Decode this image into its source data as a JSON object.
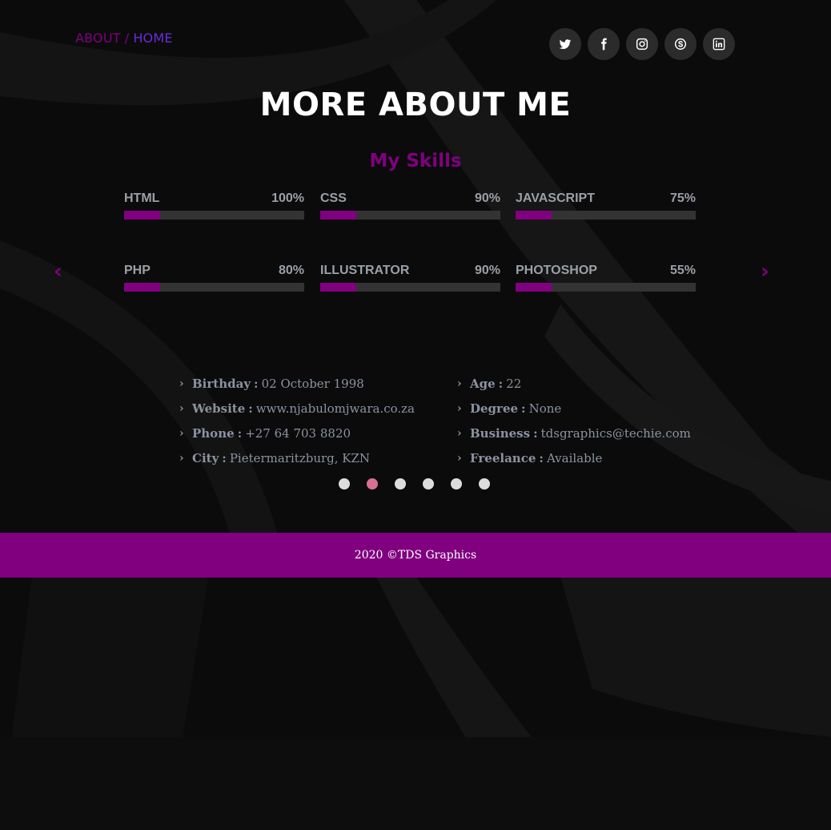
{
  "breadcrumb": {
    "about": "ABOUT",
    "separator": "/",
    "home": "HOME"
  },
  "socials": [
    {
      "icon": "twitter-icon"
    },
    {
      "icon": "facebook-icon"
    },
    {
      "icon": "instagram-icon"
    },
    {
      "icon": "skype-icon"
    },
    {
      "icon": "linkedin-icon"
    }
  ],
  "page_title": "MORE ABOUT ME",
  "skills_section": {
    "title": "My Skills",
    "prev_arrow": "‹",
    "next_arrow": "›",
    "skills": [
      {
        "name": "HTML",
        "percent_label": "100%",
        "bar_fill": 0.2
      },
      {
        "name": "CSS",
        "percent_label": "90%",
        "bar_fill": 0.2
      },
      {
        "name": "JAVASCRIPT",
        "percent_label": "75%",
        "bar_fill": 0.2
      },
      {
        "name": "PHP",
        "percent_label": "80%",
        "bar_fill": 0.2
      },
      {
        "name": "ILLUSTRATOR",
        "percent_label": "90%",
        "bar_fill": 0.2
      },
      {
        "name": "PHOTOSHOP",
        "percent_label": "55%",
        "bar_fill": 0.2
      }
    ]
  },
  "info": {
    "left": [
      {
        "label": "Birthday",
        "value": "02 October 1998"
      },
      {
        "label": "Website",
        "value": "www.njabulomjwara.co.za"
      },
      {
        "label": "Phone",
        "value": "+27 64 703 8820"
      },
      {
        "label": "City",
        "value": "Pietermaritzburg, KZN"
      }
    ],
    "right": [
      {
        "label": "Age",
        "value": "22"
      },
      {
        "label": "Degree",
        "value": "None"
      },
      {
        "label": "Business",
        "value": "tdsgraphics@techie.com"
      },
      {
        "label": "Freelance",
        "value": "Available"
      }
    ],
    "chevron": "›",
    "colon": ":"
  },
  "carousel": {
    "dot_count": 6,
    "active_index": 1
  },
  "footer": {
    "text": "2020 ©TDS Graphics"
  },
  "colors": {
    "accent": "#800080",
    "home_link": "#6a2bd6",
    "active_dot": "#d87093",
    "background": "#0b0b0b",
    "track": "#333333"
  }
}
